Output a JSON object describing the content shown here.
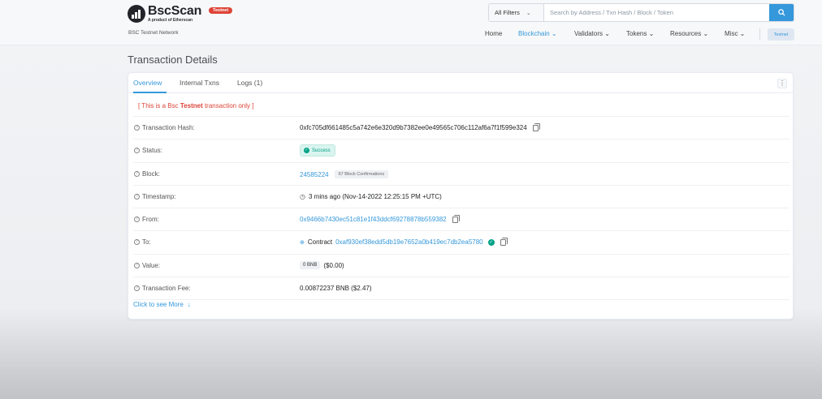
{
  "header": {
    "logo_name": "BscScan",
    "logo_sub": "A product of Etherscan",
    "badge": "Testnet",
    "network": "BSC Testnet Network",
    "search": {
      "filter": "All Filters",
      "placeholder": "Search by Address / Txn Hash / Block / Token",
      "value": ""
    },
    "nav": {
      "home": "Home",
      "blockchain": "Blockchain",
      "validators": "Validators",
      "tokens": "Tokens",
      "resources": "Resources",
      "misc": "Misc",
      "testnet": "Testnet"
    }
  },
  "page": {
    "title": "Transaction Details"
  },
  "tabs": {
    "overview": "Overview",
    "internal": "Internal Txns",
    "logs": "Logs (1)"
  },
  "warning": {
    "prefix": "[ This is a Bsc ",
    "bold": "Testnet",
    "suffix": " transaction only ]"
  },
  "rows": {
    "hash": {
      "label": "Transaction Hash:",
      "value": "0xfc705df661485c5a742e6e320d9b7382ee0e49565c706c112af6a7f1f599e324"
    },
    "status": {
      "label": "Status:",
      "value": "Success"
    },
    "block": {
      "label": "Block:",
      "value": "24585224",
      "confirmations": "67 Block Confirmations"
    },
    "timestamp": {
      "label": "Timestamp:",
      "value": "3 mins ago (Nov-14-2022 12:25:15 PM +UTC)"
    },
    "from": {
      "label": "From:",
      "value": "0x9466b7430ec51c81e1f43ddcf69278878b559382"
    },
    "to": {
      "label": "To:",
      "prefix": "Contract",
      "value": "0xaf930ef38edd5db19e7652a0b419ec7db2ea5780"
    },
    "value": {
      "label": "Value:",
      "amount": "0 BNB",
      "usd": "($0.00)"
    },
    "fee": {
      "label": "Transaction Fee:",
      "value": "0.00872237 BNB ($2.47)"
    }
  },
  "more": {
    "label": "Click to see More",
    "arrow": "↓"
  },
  "colors": {
    "accent": "#3498db",
    "danger": "#de4437",
    "success": "#00a186"
  }
}
